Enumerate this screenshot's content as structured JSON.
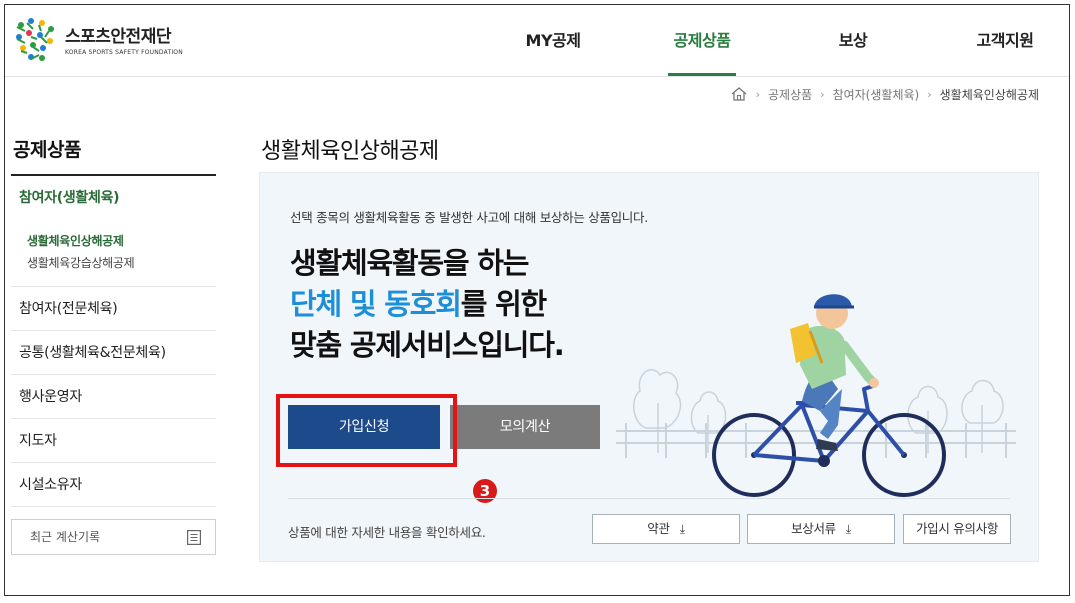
{
  "logo": {
    "name_ko": "스포츠안전재단",
    "name_en": "KOREA SPORTS SAFETY FOUNDATION"
  },
  "gnb": {
    "items": [
      {
        "label": "MY공제",
        "active": false
      },
      {
        "label": "공제상품",
        "active": true
      },
      {
        "label": "보상",
        "active": false
      },
      {
        "label": "고객지원",
        "active": false
      }
    ],
    "active_color": "#2a7c3f"
  },
  "breadcrumb": {
    "home_icon": "home-icon",
    "items": [
      "공제상품",
      "참여자(생활체육)",
      "생활체육인상해공제"
    ]
  },
  "sidebar": {
    "title": "공제상품",
    "groups": [
      {
        "label": "참여자(생활체육)",
        "active": true,
        "sub": [
          {
            "label": "생활체육인상해공제",
            "active": true
          },
          {
            "label": "생활체육강습상해공제",
            "active": false
          }
        ]
      },
      {
        "label": "참여자(전문체육)"
      },
      {
        "label": "공통(생활체육&전문체육)"
      },
      {
        "label": "행사운영자"
      },
      {
        "label": "지도자"
      },
      {
        "label": "시설소유자"
      }
    ],
    "recent_button": "최근 계산기록",
    "recent_icon": "document-list-icon"
  },
  "main": {
    "page_title": "생활체육인상해공제",
    "description": "선택 종목의 생활체육활동 중 발생한 사고에 대해 보상하는 상품입니다.",
    "headline": {
      "line1": "생활체육활동을 하는",
      "line2_highlight": "단체 및 동호회",
      "line2_rest": "를 위한",
      "line3": "맞춤 공제서비스입니다."
    },
    "join_button": "가입신청",
    "calc_button": "모의계산",
    "step_badge": "3",
    "footer_text": "상품에 대한 자세한 내용을 확인하세요.",
    "doc_buttons": [
      {
        "label": "약관",
        "icon": "download-icon"
      },
      {
        "label": "보상서류",
        "icon": "download-icon"
      },
      {
        "label": "가입시 유의사항"
      }
    ],
    "highlight_color": "#1d8fd8",
    "join_color": "#1d4a8a",
    "annotation_color": "#e51414"
  }
}
